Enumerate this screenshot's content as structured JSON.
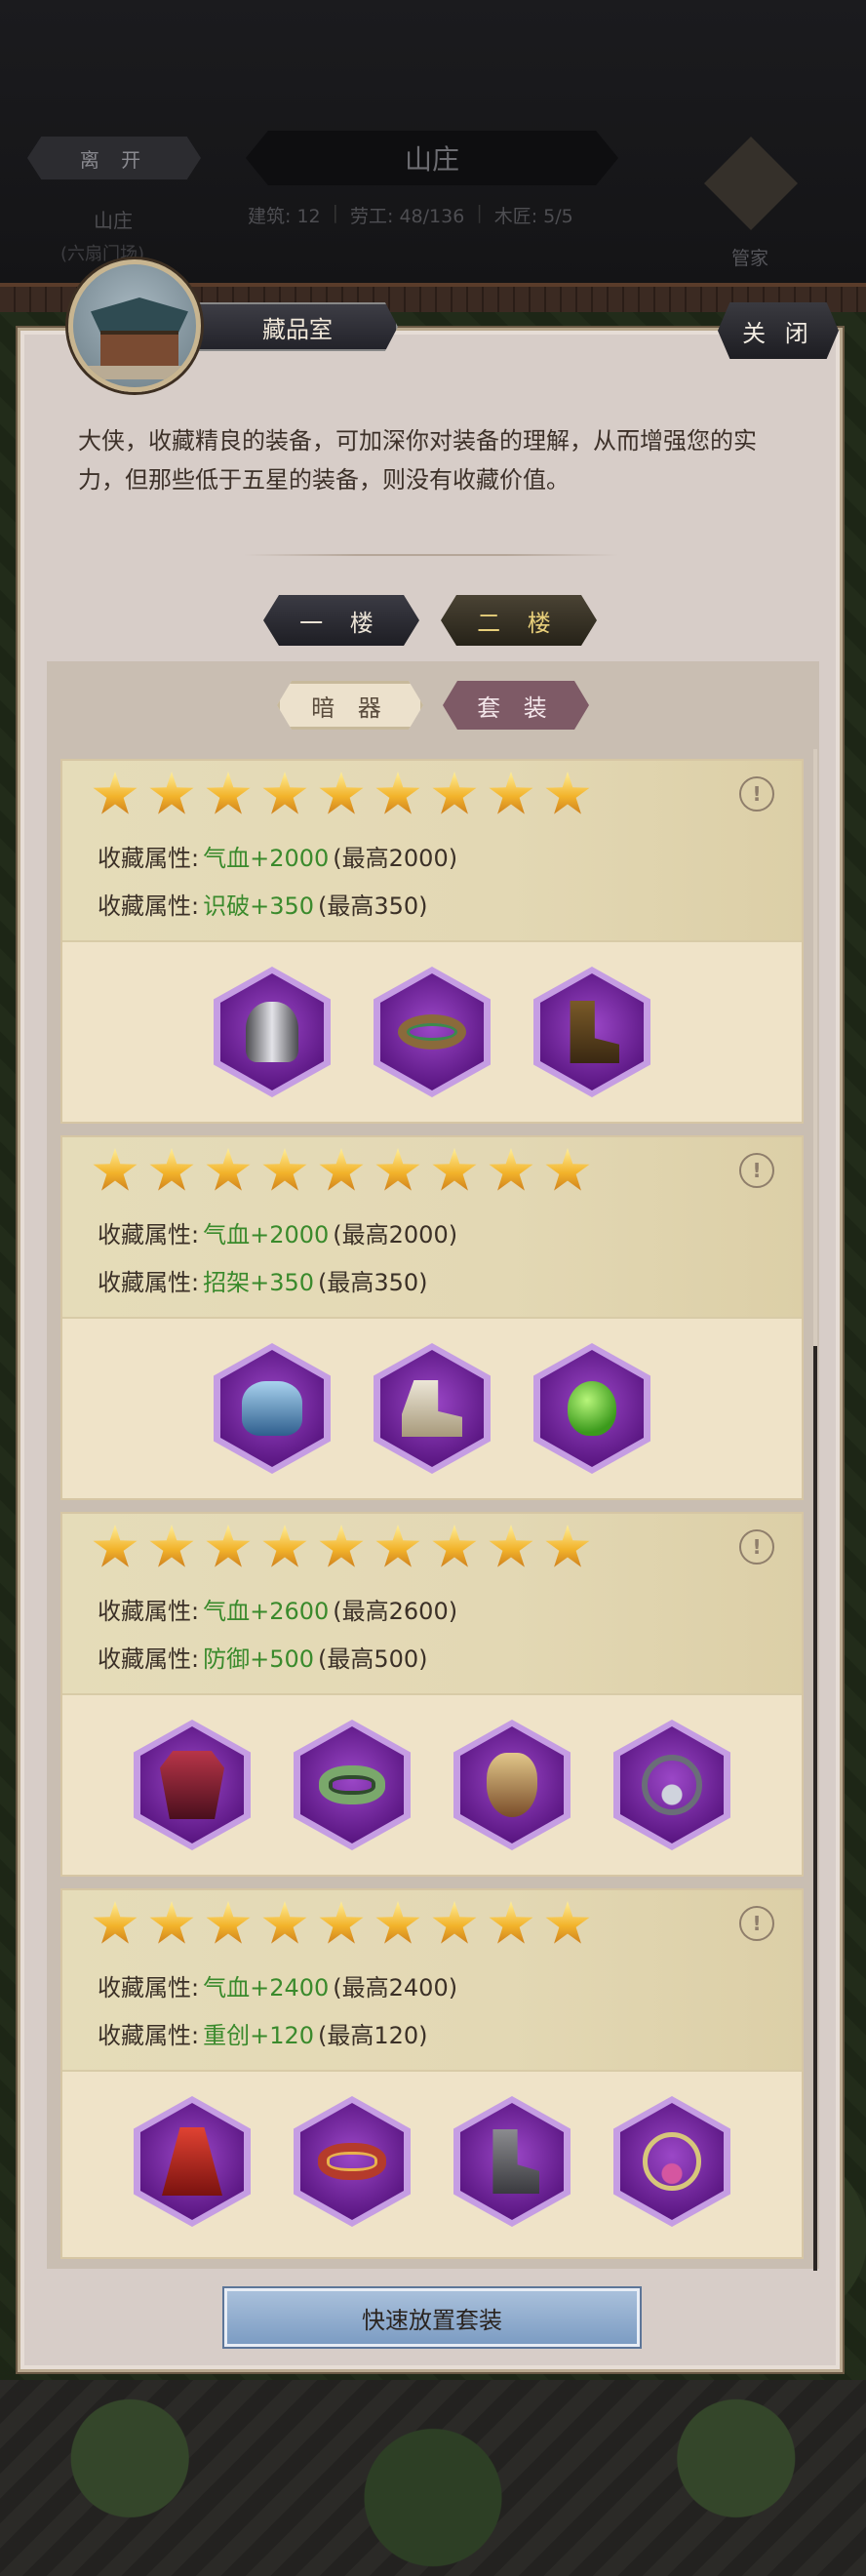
{
  "hud": {
    "leave_label": "离 开",
    "leave_sub1": "山庄",
    "leave_sub2": "(六扇门场)",
    "place_title": "山庄",
    "stats": [
      "建筑: 12",
      "劳工: 48/136",
      "木匠: 5/5"
    ],
    "butler_label": "管家"
  },
  "panel": {
    "room_title": "藏品室",
    "close_label": "关 闭",
    "description": "大侠，收藏精良的装备，可加深你对装备的理解，从而增强您的实力，但那些低于五星的装备，则没有收藏价值。",
    "floors": [
      "一 楼",
      "二 楼"
    ],
    "categories": [
      "暗 器",
      "套 装"
    ],
    "quick_button": "快速放置套装"
  },
  "cards": [
    {
      "stars": 9,
      "attributes": [
        {
          "label": "收藏属性:",
          "value": "气血+2000",
          "max": "(最高2000)"
        },
        {
          "label": "收藏属性:",
          "value": "识破+350",
          "max": "(最高350)"
        }
      ],
      "items": [
        "helmet-icon",
        "belt-icon",
        "boots-icon"
      ]
    },
    {
      "stars": 9,
      "attributes": [
        {
          "label": "收藏属性:",
          "value": "气血+2000",
          "max": "(最高2000)"
        },
        {
          "label": "收藏属性:",
          "value": "招架+350",
          "max": "(最高350)"
        }
      ],
      "items": [
        "gloves-icon",
        "shoes-icon",
        "jade-pendant-icon"
      ]
    },
    {
      "stars": 9,
      "attributes": [
        {
          "label": "收藏属性:",
          "value": "气血+2600",
          "max": "(最高2600)"
        },
        {
          "label": "收藏属性:",
          "value": "防御+500",
          "max": "(最高500)"
        }
      ],
      "items": [
        "armor-icon",
        "ring-icon",
        "mask-icon",
        "necklace-icon"
      ]
    },
    {
      "stars": 9,
      "attributes": [
        {
          "label": "收藏属性:",
          "value": "气血+2400",
          "max": "(最高2400)"
        },
        {
          "label": "收藏属性:",
          "value": "重创+120",
          "max": "(最高120)"
        }
      ],
      "items": [
        "cape-icon",
        "bracer-icon",
        "greaves-icon",
        "pendant-icon"
      ]
    }
  ],
  "colors": {
    "panel_bg": "#d7cdc8",
    "attr_value": "#3a8a2c",
    "item_frame": "#5a1682",
    "quick_button": "#8eabd0"
  }
}
